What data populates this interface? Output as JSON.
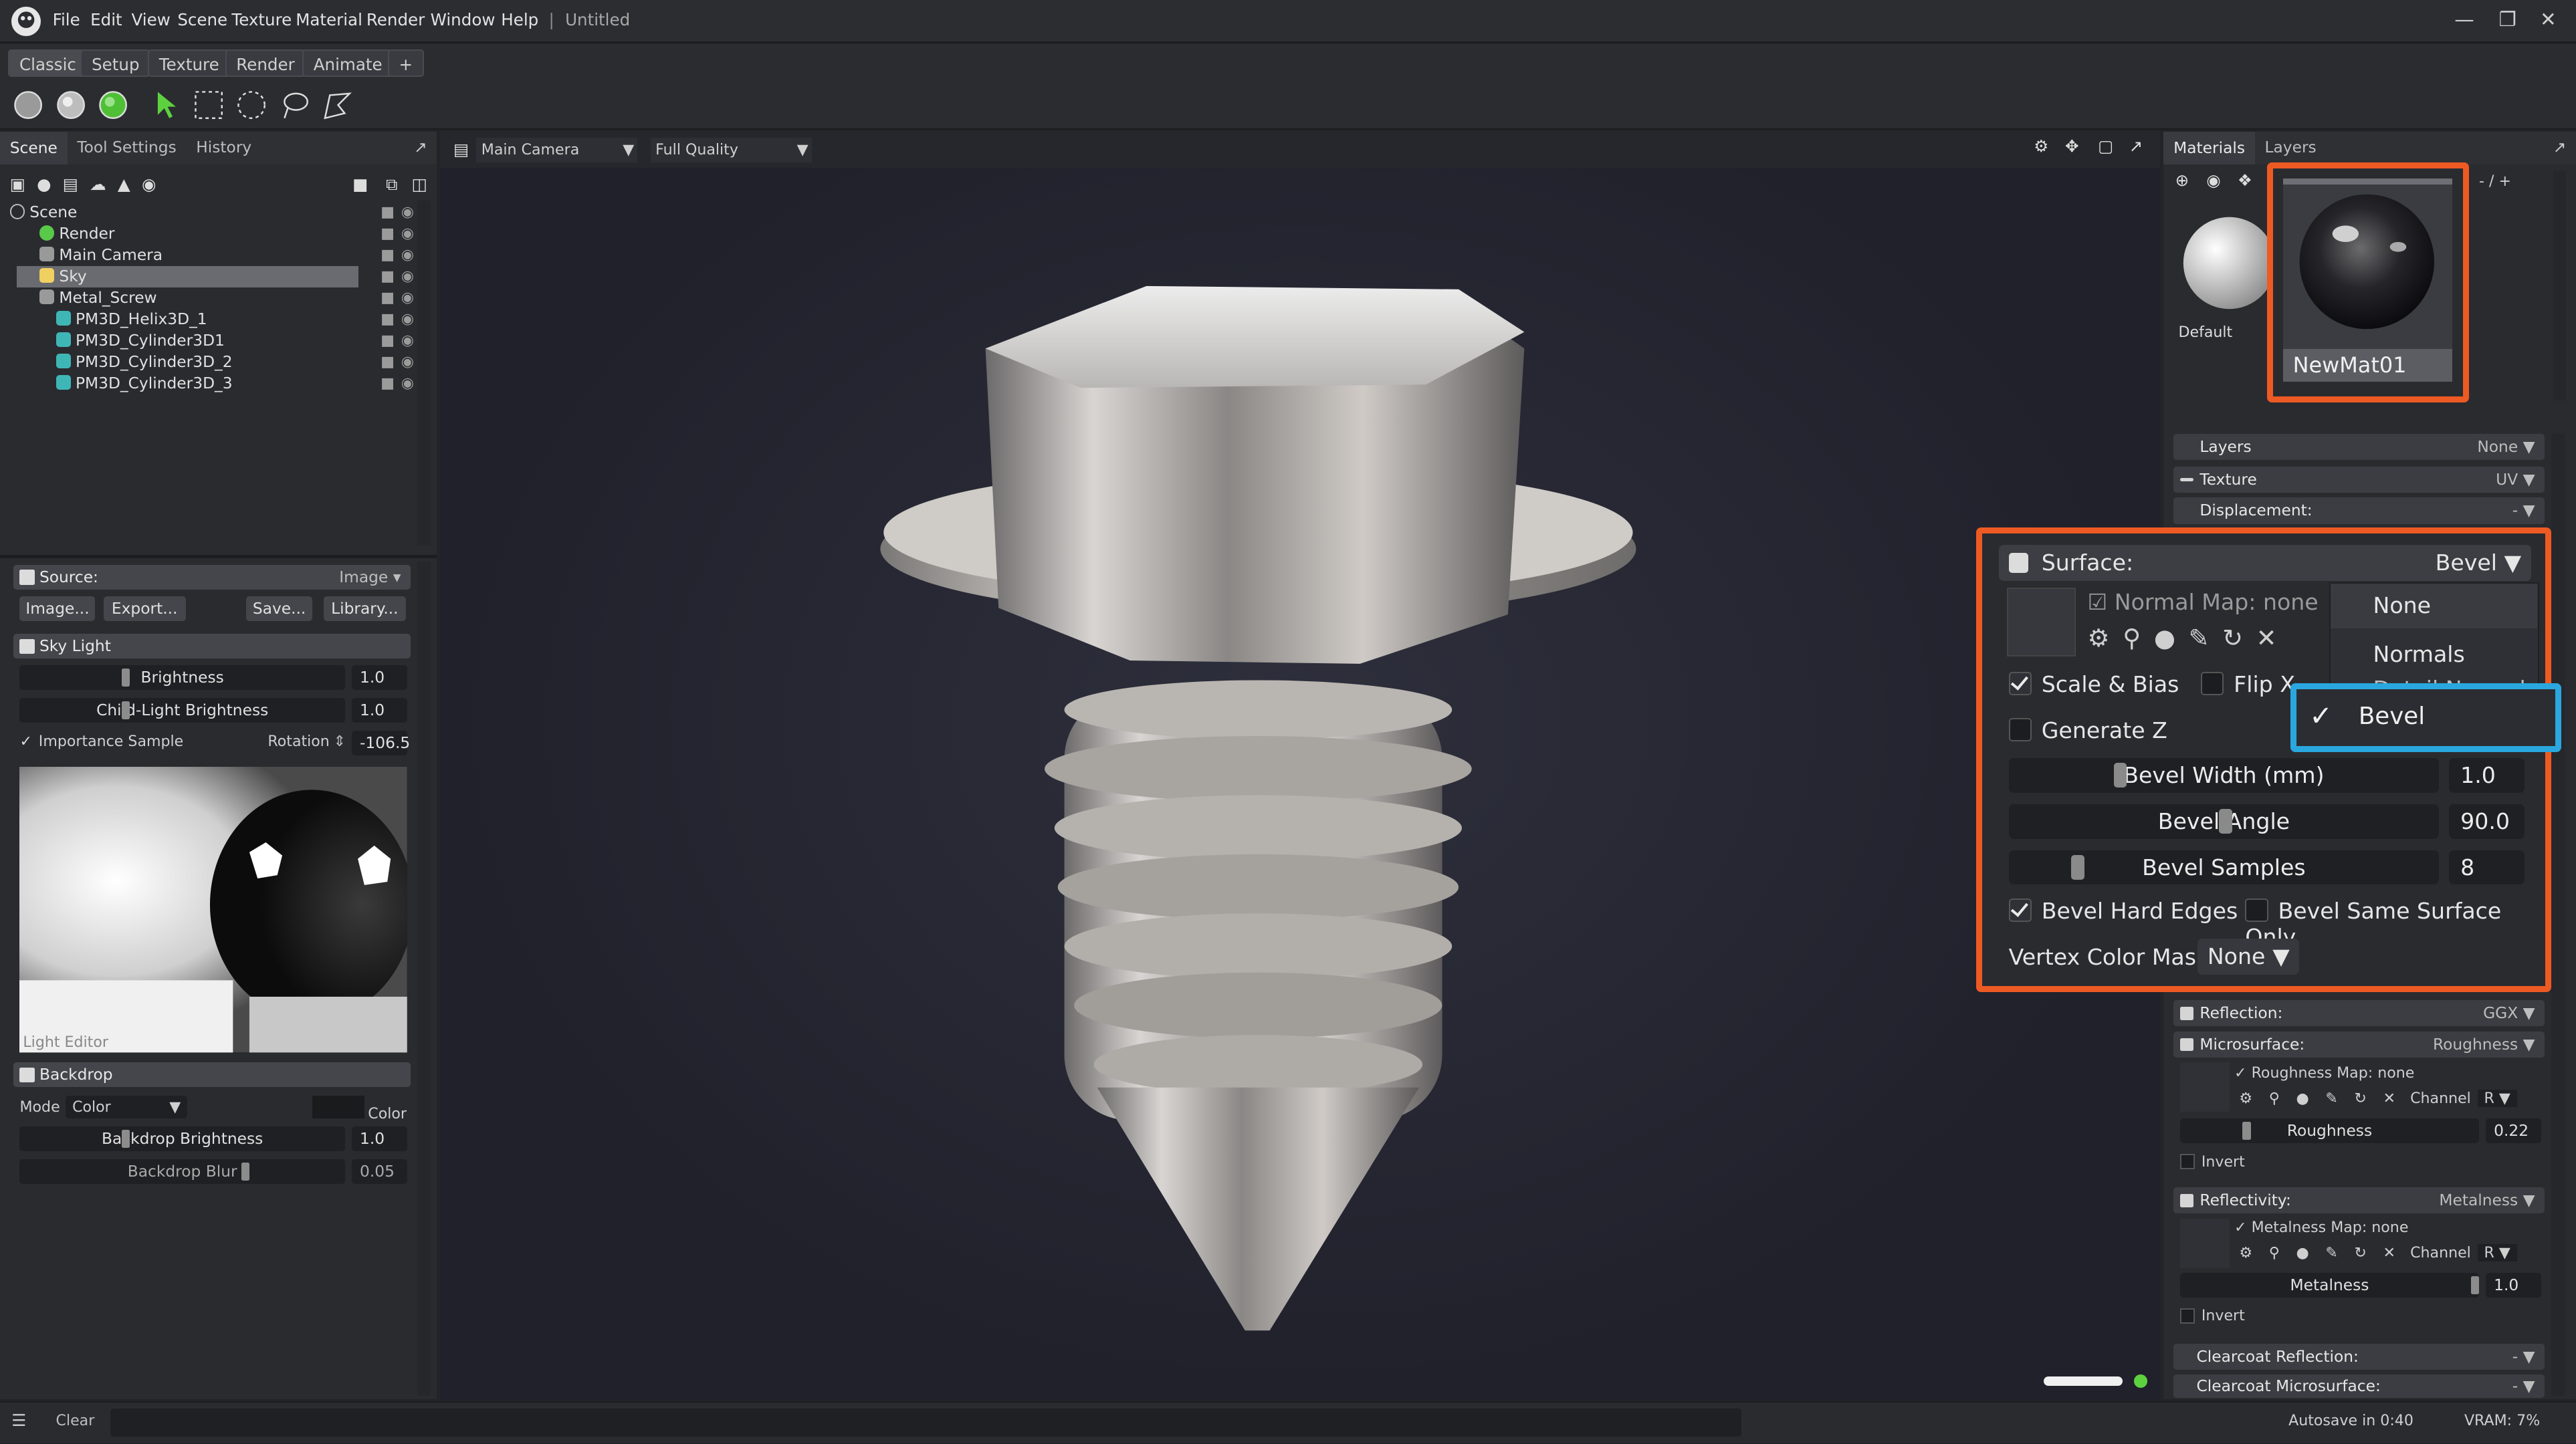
{
  "app": {
    "doc_title": "Untitled"
  },
  "menu": [
    "File",
    "Edit",
    "View",
    "Scene",
    "Texture",
    "Material",
    "Render",
    "Window",
    "Help"
  ],
  "workspace_tabs": [
    "Classic",
    "Setup",
    "Texture",
    "Render",
    "Animate",
    "+"
  ],
  "left_tabs": [
    "Scene",
    "Tool Settings",
    "History"
  ],
  "scene_tree": [
    {
      "label": "Scene",
      "color": "#bdbdbd"
    },
    {
      "label": "Render",
      "color": "#59c94a"
    },
    {
      "label": "Main Camera",
      "color": "#bdbdbd"
    },
    {
      "label": "Sky",
      "color": "#f0d060"
    },
    {
      "label": "Metal_Screw",
      "color": "#bdbdbd"
    },
    {
      "label": "PM3D_Helix3D_1",
      "color": "#3fb6b6"
    },
    {
      "label": "PM3D_Cylinder3D1",
      "color": "#3fb6b6"
    },
    {
      "label": "PM3D_Cylinder3D_2",
      "color": "#3fb6b6"
    },
    {
      "label": "PM3D_Cylinder3D_3",
      "color": "#3fb6b6"
    }
  ],
  "source": {
    "label": "Source:",
    "value": "Image",
    "buttons": [
      "Image...",
      "Export...",
      "Save...",
      "Library..."
    ]
  },
  "sky_light": {
    "title": "Sky Light",
    "brightness_label": "Brightness",
    "brightness": "1.0",
    "child_label": "Child-Light Brightness",
    "child": "1.0",
    "importance": "Importance Sample",
    "rotation_label": "Rotation",
    "rotation": "-106.5",
    "editor_label": "Light Editor"
  },
  "backdrop": {
    "title": "Backdrop",
    "mode_label": "Mode",
    "mode": "Color",
    "color_label": "Color",
    "brightness_label": "Backdrop Brightness",
    "brightness": "1.0",
    "blur_label": "Backdrop Blur",
    "blur": "0.05"
  },
  "viewport": {
    "camera": "Main Camera",
    "quality": "Full Quality"
  },
  "right_tabs": [
    "Materials",
    "Layers"
  ],
  "materials": [
    {
      "name": "Default"
    },
    {
      "name": "NewMat01"
    }
  ],
  "material_range": "- / +",
  "right_sections": {
    "layers": {
      "label": "Layers",
      "value": "None"
    },
    "texture": {
      "label": "Texture",
      "value": "UV"
    },
    "displacement": {
      "label": "Displacement:",
      "value": "-"
    },
    "reflection": {
      "label": "Reflection:",
      "value": "GGX"
    },
    "microsurface": {
      "label": "Microsurface:",
      "value": "Roughness",
      "map": "Roughness Map: none",
      "channel_label": "Channel",
      "channel": "R",
      "slider_label": "Roughness",
      "slider_value": "0.22",
      "invert": "Invert"
    },
    "reflectivity": {
      "label": "Reflectivity:",
      "value": "Metalness",
      "map": "Metalness Map: none",
      "channel_label": "Channel",
      "channel": "R",
      "slider_label": "Metalness",
      "slider_value": "1.0",
      "invert": "Invert"
    },
    "clearcoat_reflection": {
      "label": "Clearcoat Reflection:",
      "value": "-"
    },
    "clearcoat_microsurface": {
      "label": "Clearcoat Microsurface:",
      "value": "-"
    }
  },
  "surface": {
    "label": "Surface:",
    "value": "Bevel",
    "normal_map": "Normal Map: none",
    "scale_bias": "Scale & Bias",
    "flip_x": "Flip X",
    "generate_z": "Generate Z",
    "bevel_width_label": "Bevel Width (mm)",
    "bevel_width": "1.0",
    "bevel_angle_label": "Bevel Angle",
    "bevel_angle": "90.0",
    "bevel_samples_label": "Bevel Samples",
    "bevel_samples": "8",
    "hard_edges": "Bevel Hard Edges",
    "same_surface": "Bevel Same Surface Only",
    "vertex_mask_label": "Vertex Color Mask",
    "vertex_mask": "None",
    "dropdown": [
      "None",
      "Normals",
      "Detail Normals",
      "Bevel"
    ],
    "selected": "Bevel"
  },
  "status": {
    "clear": "Clear",
    "autosave": "Autosave in 0:40",
    "vram": "VRAM: 7%"
  },
  "colors": {
    "highlight_orange": "#ee5a23",
    "highlight_blue": "#2aa7df",
    "accent_green": "#5ed13f"
  }
}
